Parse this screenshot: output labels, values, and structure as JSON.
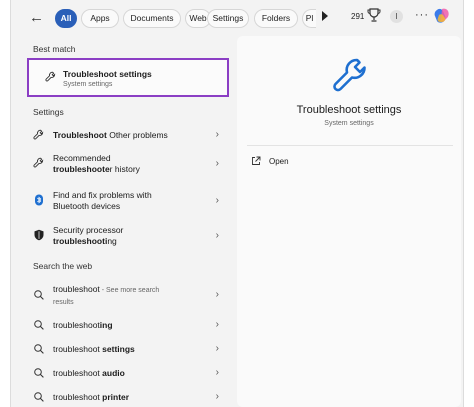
{
  "filters": {
    "back": "←",
    "tabs": [
      "All",
      "Apps",
      "Documents",
      "Web",
      "Settings",
      "Folders",
      "Pl"
    ],
    "points": "291",
    "avatar_initial": "I",
    "more": "···"
  },
  "best_match": {
    "heading": "Best match",
    "title": "Troubleshoot settings",
    "subtitle": "System settings"
  },
  "settings": {
    "heading": "Settings",
    "items": [
      {
        "pre": "",
        "bold": "Troubleshoot",
        "post": " Other problems"
      },
      {
        "pre": "Recommended ",
        "bold": "troubleshoote",
        "post": "r history"
      },
      {
        "pre": "Find and fix problems with Bluetooth devices",
        "bold": "",
        "post": ""
      },
      {
        "pre": "Security processor ",
        "bold": "troubleshooti",
        "post": "ng"
      }
    ]
  },
  "web": {
    "heading": "Search the web",
    "first": {
      "term": "troubleshoot",
      "note": " - See more search results"
    },
    "items": [
      {
        "pre": "troubleshoot",
        "bold": "ing"
      },
      {
        "pre": "troubleshoot ",
        "bold": "settings"
      },
      {
        "pre": "troubleshoot ",
        "bold": "audio"
      },
      {
        "pre": "troubleshoot ",
        "bold": "printer"
      }
    ]
  },
  "detail": {
    "title": "Troubleshoot settings",
    "subtitle": "System settings",
    "open_label": "Open"
  },
  "colors": {
    "accent": "#2a5fb8",
    "highlight_border": "#8b3ec4",
    "icon_blue": "#1e6fd0"
  },
  "chevron": "›"
}
